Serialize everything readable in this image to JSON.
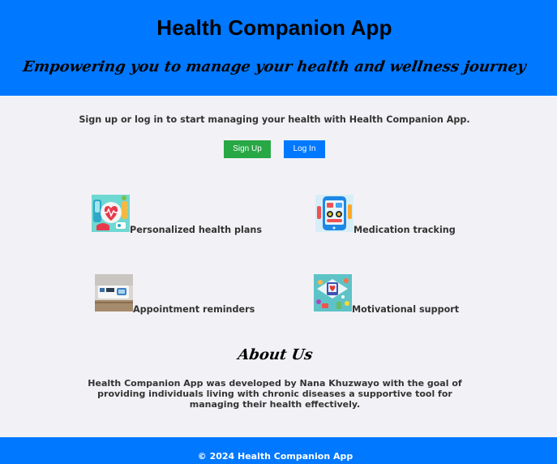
{
  "header": {
    "title": "Health Companion App",
    "subtitle": "Empowering you to manage your health and wellness journey"
  },
  "intro": {
    "text": "Sign up or log in to start managing your health with Health Companion App.",
    "signup_label": "Sign Up",
    "login_label": "Log In"
  },
  "features": [
    {
      "label": "Personalized health plans",
      "icon": "health-plan-icon"
    },
    {
      "label": "Medication tracking",
      "icon": "medication-tracker-icon"
    },
    {
      "label": "Appointment reminders",
      "icon": "appointment-reminder-icon"
    },
    {
      "label": "Motivational support",
      "icon": "motivational-support-icon"
    }
  ],
  "about": {
    "title": "About Us",
    "text": "Health Companion App was developed by Nana Khuzwayo with the goal of providing individuals living with chronic diseases a supportive tool for managing their health effectively."
  },
  "footer": {
    "copyright": "© 2024 Health Companion App"
  },
  "colors": {
    "primary": "#0078ff",
    "signup": "#28a745",
    "background": "#f2f2f6",
    "text": "#333333"
  }
}
